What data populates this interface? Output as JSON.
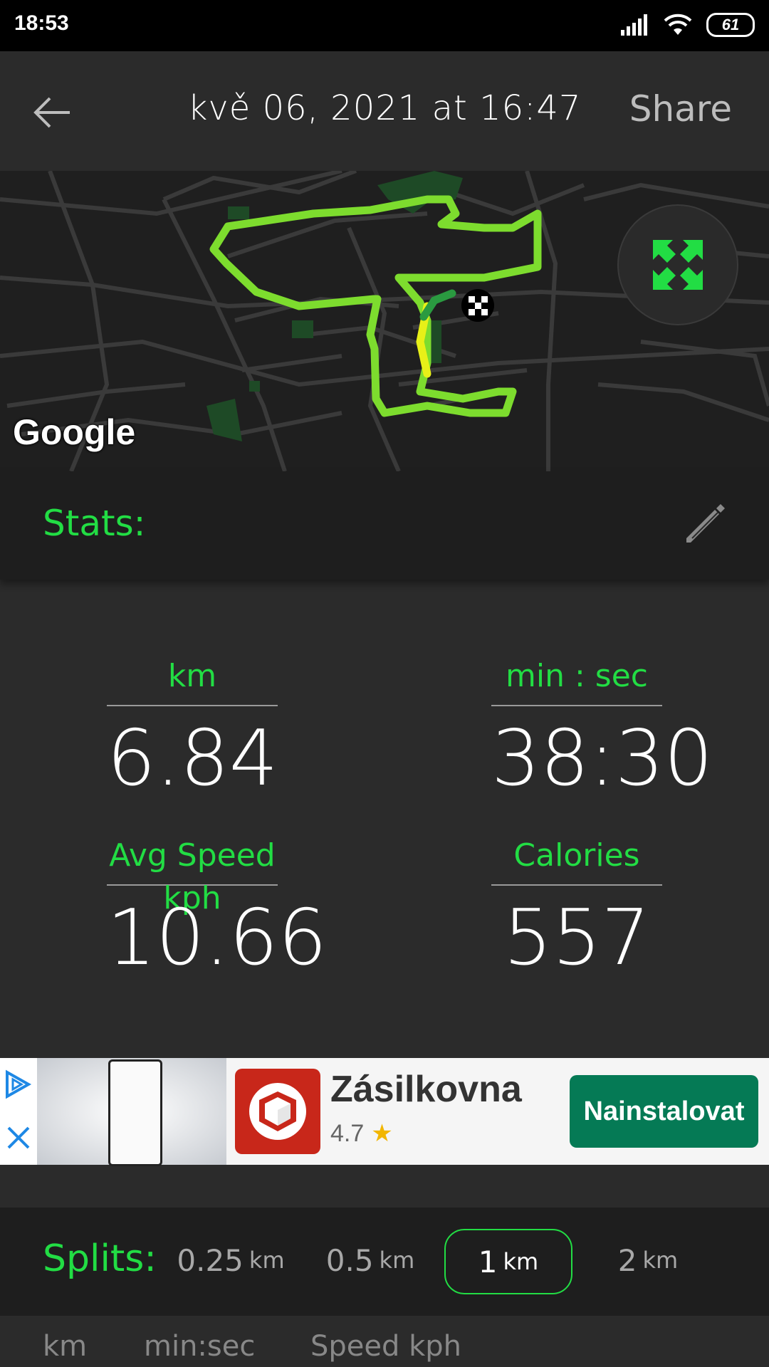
{
  "status_bar": {
    "time": "18:53",
    "battery": "61"
  },
  "header": {
    "title": "kvě 06, 2021 at 16:47",
    "share_label": "Share",
    "back_icon": "arrow-left-icon"
  },
  "map": {
    "attribution": "Google",
    "fullscreen_icon": "expand-icon",
    "route_color": "#7ddc2e",
    "finish_icon": "checkered-flag-icon"
  },
  "stats": {
    "label": "Stats:",
    "edit_icon": "pencil-icon",
    "items": [
      {
        "caption": "km",
        "value": "6.84"
      },
      {
        "caption": "min : sec",
        "value": "38:30"
      },
      {
        "caption": "Avg Speed kph",
        "value": "10.66"
      },
      {
        "caption": "Calories",
        "value": "557"
      }
    ]
  },
  "ad": {
    "app_name": "Zásilkovna",
    "rating": "4.7",
    "rating_icon": "star-icon",
    "install_label": "Nainstalovat",
    "brand_color": "#057a55"
  },
  "splits": {
    "label": "Splits:",
    "options": [
      {
        "value": "0.25",
        "unit": "km",
        "active": false
      },
      {
        "value": "0.5",
        "unit": "km",
        "active": false
      },
      {
        "value": "1",
        "unit": "km",
        "active": true
      },
      {
        "value": "2",
        "unit": "km",
        "active": false
      }
    ],
    "columns": [
      "km",
      "min:sec",
      "Speed kph"
    ]
  },
  "accent_color": "#22dd44"
}
